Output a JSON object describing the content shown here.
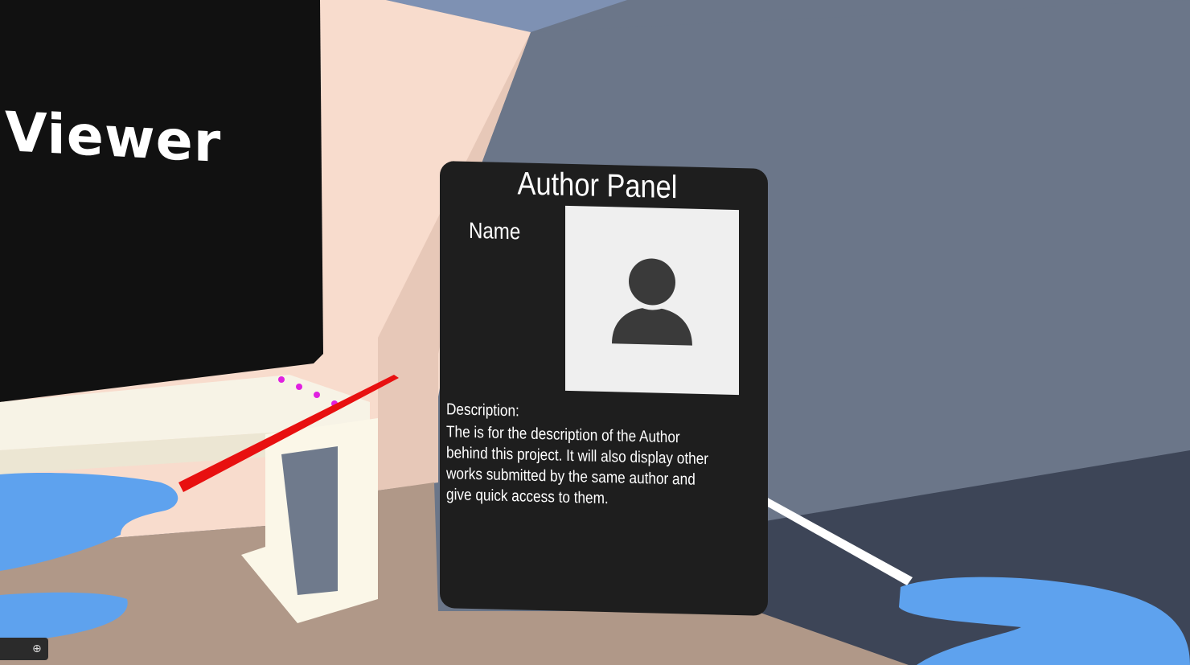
{
  "viewer": {
    "title": "Viewer"
  },
  "author_panel": {
    "title": "Author Panel",
    "name_label": "Name",
    "avatar_icon": "user-silhouette-icon",
    "description_label": "Description:",
    "description_text": "The is for the description of the Author behind this project. It will also display other works submitted by the same author and give quick access to them."
  },
  "toolbar": {
    "icon": "add-circle-icon"
  },
  "colors": {
    "wall_back": "#6b7689",
    "wall_left": "#f8dccd",
    "floor": "#b09888",
    "panel_bg": "#1e1e1e",
    "avatar_bg": "#efefef",
    "hand": "#5ea2ee",
    "left_laser": "#e81010",
    "right_laser": "#ffffff"
  }
}
